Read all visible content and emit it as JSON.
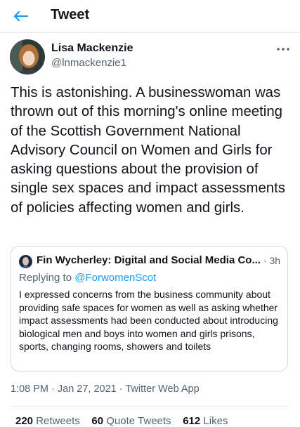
{
  "header": {
    "title": "Tweet"
  },
  "author": {
    "name": "Lisa Mackenzie",
    "handle": "@lnmackenzie1"
  },
  "tweet": {
    "text": "This is astonishing. A businesswoman was thrown out of this morning's online meeting of the Scottish Government National Advisory Council on Women and Girls for asking questions about the provision of single sex spaces and impact assessments of policies affecting women and girls."
  },
  "quoted": {
    "name": "Fin Wycherley: Digital and Social Media Co...",
    "time": "· 3h",
    "replying_prefix": "Replying to ",
    "replying_handle": "@ForwomenScot",
    "text": "I expressed concerns from the business community about providing safe spaces for women as well as asking whether  impact assessments had been conducted about introducing biological men and boys into women and girls prisons, sports, changing rooms, showers and toilets"
  },
  "meta": {
    "time": "1:08 PM",
    "date": "Jan 27, 2021",
    "source": "Twitter Web App"
  },
  "stats": {
    "retweets_count": "220",
    "retweets_label": "Retweets",
    "quotes_count": "60",
    "quotes_label": "Quote Tweets",
    "likes_count": "612",
    "likes_label": "Likes"
  },
  "colors": {
    "accent": "#1d9bf0",
    "secondary": "#536471",
    "border": "#cfd9de"
  },
  "icons": {
    "back": "arrow-left-icon",
    "more": "more-horizontal-icon"
  }
}
